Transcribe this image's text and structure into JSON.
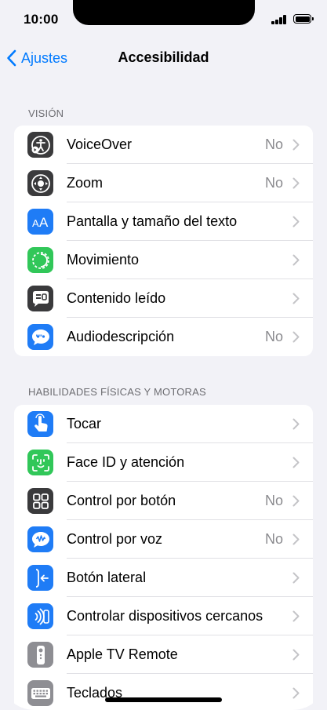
{
  "status": {
    "time": "10:00"
  },
  "nav": {
    "back_label": "Ajustes",
    "title": "Accesibilidad"
  },
  "colors": {
    "accent": "#007aff",
    "group_bg": "#ffffff",
    "page_bg": "#f2f2f7"
  },
  "sections": [
    {
      "header": "VISIÓN",
      "items": [
        {
          "label": "VoiceOver",
          "value": "No",
          "icon": "voiceover-icon",
          "icon_color": "#3a3a3c"
        },
        {
          "label": "Zoom",
          "value": "No",
          "icon": "zoom-icon",
          "icon_color": "#3a3a3c"
        },
        {
          "label": "Pantalla y tamaño del texto",
          "value": "",
          "icon": "text-size-icon",
          "icon_color": "#1f7cf6"
        },
        {
          "label": "Movimiento",
          "value": "",
          "icon": "motion-icon",
          "icon_color": "#31c759"
        },
        {
          "label": "Contenido leído",
          "value": "",
          "icon": "spoken-content-icon",
          "icon_color": "#3a3a3c"
        },
        {
          "label": "Audiodescripción",
          "value": "No",
          "icon": "audio-description-icon",
          "icon_color": "#1f7cf6"
        }
      ]
    },
    {
      "header": "HABILIDADES FÍSICAS Y MOTORAS",
      "items": [
        {
          "label": "Tocar",
          "value": "",
          "icon": "touch-icon",
          "icon_color": "#1f7cf6"
        },
        {
          "label": "Face ID y atención",
          "value": "",
          "icon": "face-id-icon",
          "icon_color": "#31c759"
        },
        {
          "label": "Control por botón",
          "value": "No",
          "icon": "switch-control-icon",
          "icon_color": "#3a3a3c"
        },
        {
          "label": "Control por voz",
          "value": "No",
          "icon": "voice-control-icon",
          "icon_color": "#1f7cf6"
        },
        {
          "label": "Botón lateral",
          "value": "",
          "icon": "side-button-icon",
          "icon_color": "#1f7cf6"
        },
        {
          "label": "Controlar dispositivos cercanos",
          "value": "",
          "icon": "nearby-devices-icon",
          "icon_color": "#1f7cf6"
        },
        {
          "label": "Apple TV Remote",
          "value": "",
          "icon": "tv-remote-icon",
          "icon_color": "#8e8e93"
        },
        {
          "label": "Teclados",
          "value": "",
          "icon": "keyboard-icon",
          "icon_color": "#8e8e93"
        }
      ]
    }
  ]
}
